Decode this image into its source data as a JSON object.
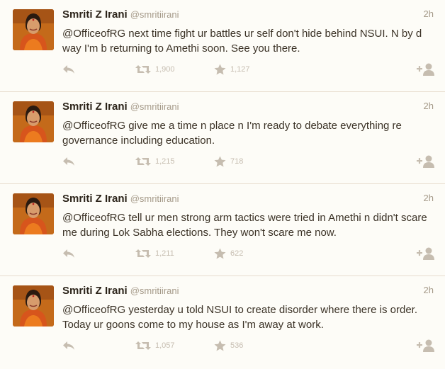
{
  "tweets": [
    {
      "name": "Smriti Z Irani",
      "handle": "@smritiirani",
      "time": "2h",
      "text": "@OfficeofRG next time fight ur battles ur self don't hide behind NSUI. N by d way I'm b returning to Amethi soon. See you there.",
      "retweets": "1,900",
      "favorites": "1,127"
    },
    {
      "name": "Smriti Z Irani",
      "handle": "@smritiirani",
      "time": "2h",
      "text": "@OfficeofRG give me a time n place n I'm ready to debate everything re governance including education.",
      "retweets": "1,215",
      "favorites": "718"
    },
    {
      "name": "Smriti Z Irani",
      "handle": "@smritiirani",
      "time": "2h",
      "text": "@OfficeofRG tell ur men strong arm tactics were tried in Amethi n didn't scare me during Lok Sabha elections. They won't scare me now.",
      "retweets": "1,211",
      "favorites": "622"
    },
    {
      "name": "Smriti Z Irani",
      "handle": "@smritiirani",
      "time": "2h",
      "text": "@OfficeofRG yesterday u told NSUI to create disorder where there is order. Today ur goons come to my house as I'm away at work.",
      "retweets": "1,057",
      "favorites": "536"
    }
  ],
  "icons": {
    "reply": "reply-icon",
    "retweet": "retweet-icon",
    "favorite": "star-icon",
    "follow": "follow-icon"
  },
  "colors": {
    "background": "#fdfcf7",
    "text": "#3b3226",
    "muted": "#a59a89",
    "icon": "#c6bdb0",
    "divider": "#e7dccd"
  }
}
